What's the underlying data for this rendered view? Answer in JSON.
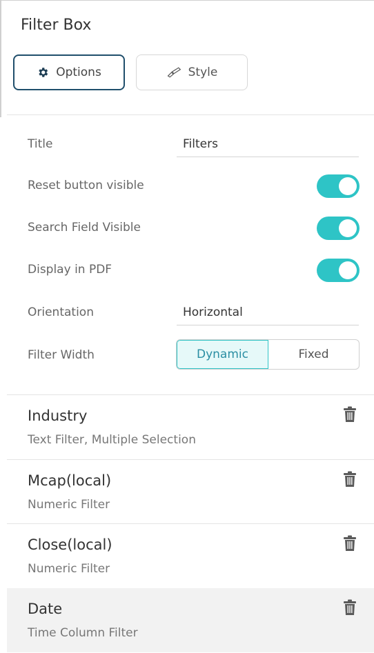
{
  "panel": {
    "title": "Filter Box",
    "tabs": [
      {
        "label": "Options",
        "icon": "gear-icon",
        "active": true
      },
      {
        "label": "Style",
        "icon": "brush-icon",
        "active": false
      }
    ]
  },
  "options": {
    "title_label": "Title",
    "title_value": "Filters",
    "reset_label": "Reset button visible",
    "reset_on": true,
    "search_label": "Search Field Visible",
    "search_on": true,
    "pdf_label": "Display in PDF",
    "pdf_on": true,
    "orientation_label": "Orientation",
    "orientation_value": "Horizontal",
    "width_label": "Filter Width",
    "width_options": [
      "Dynamic",
      "Fixed"
    ],
    "width_selected": "Dynamic"
  },
  "filters": [
    {
      "name": "Industry",
      "desc": "Text Filter, Multiple Selection"
    },
    {
      "name": "Mcap(local)",
      "desc": "Numeric Filter"
    },
    {
      "name": "Close(local)",
      "desc": "Numeric Filter"
    },
    {
      "name": "Date",
      "desc": "Time Column Filter",
      "selected": true
    }
  ],
  "colors": {
    "accent": "#2ec4c6",
    "active_tab_border": "#1f4e6b"
  }
}
